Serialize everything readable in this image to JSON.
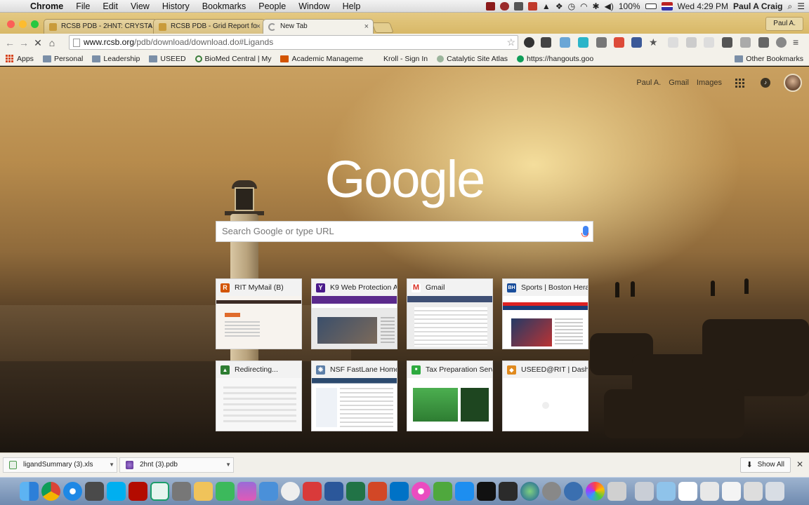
{
  "menubar": {
    "app": "Chrome",
    "items": [
      "File",
      "Edit",
      "View",
      "History",
      "Bookmarks",
      "People",
      "Window",
      "Help"
    ],
    "battery": "100%",
    "clock": "Wed 4:29 PM",
    "user": "Paul A Craig"
  },
  "tabs": [
    {
      "title": "RCSB PDB - 2HNT: CRYSTAL"
    },
    {
      "title": "RCSB PDB - Grid Report fo"
    },
    {
      "title": "New Tab"
    }
  ],
  "profile_button": "Paul A.",
  "address_bar": {
    "url_domain": "www.rcsb.org",
    "url_path": "/pdb/download/download.do#Ligands"
  },
  "bookmarks": {
    "apps": "Apps",
    "items": [
      "Personal",
      "Leadership",
      "USEED",
      "BioMed Central | My",
      "Academic Manageme",
      "Kroll - Sign In",
      "Catalytic Site Atlas",
      "https://hangouts.goo"
    ],
    "other": "Other Bookmarks"
  },
  "google_bar": {
    "user": "Paul A.",
    "gmail": "Gmail",
    "images": "Images"
  },
  "logo": "Google",
  "search": {
    "placeholder": "Search Google or type URL"
  },
  "tiles": [
    {
      "title": "RIT MyMail (B)",
      "icon": "R",
      "color": "#d35400"
    },
    {
      "title": "K9 Web Protection Ad",
      "icon": "Y",
      "color": "#4a1a8a"
    },
    {
      "title": "Gmail",
      "icon": "M",
      "color": "#d93025"
    },
    {
      "title": "Sports | Boston Herald",
      "icon": "BH",
      "color": "#1b4f9c"
    },
    {
      "title": "Redirecting...",
      "icon": "▲",
      "color": "#2e7d32"
    },
    {
      "title": "NSF FastLane Home",
      "icon": "❋",
      "color": "#5d7fa8"
    },
    {
      "title": "Tax Preparation Servi",
      "icon": "■",
      "color": "#2eaa3f"
    },
    {
      "title": "USEED@RIT | Dashbo",
      "icon": "◆",
      "color": "#e08a1e"
    }
  ],
  "downloads": [
    {
      "name": "ligandSummary (3).xls"
    },
    {
      "name": "2hnt (3).pdb"
    }
  ],
  "show_all": "Show All",
  "colors": {
    "tabstrip": "#d8b867",
    "toolbar": "#f3f1ea",
    "accent_blue": "#4285f4"
  }
}
